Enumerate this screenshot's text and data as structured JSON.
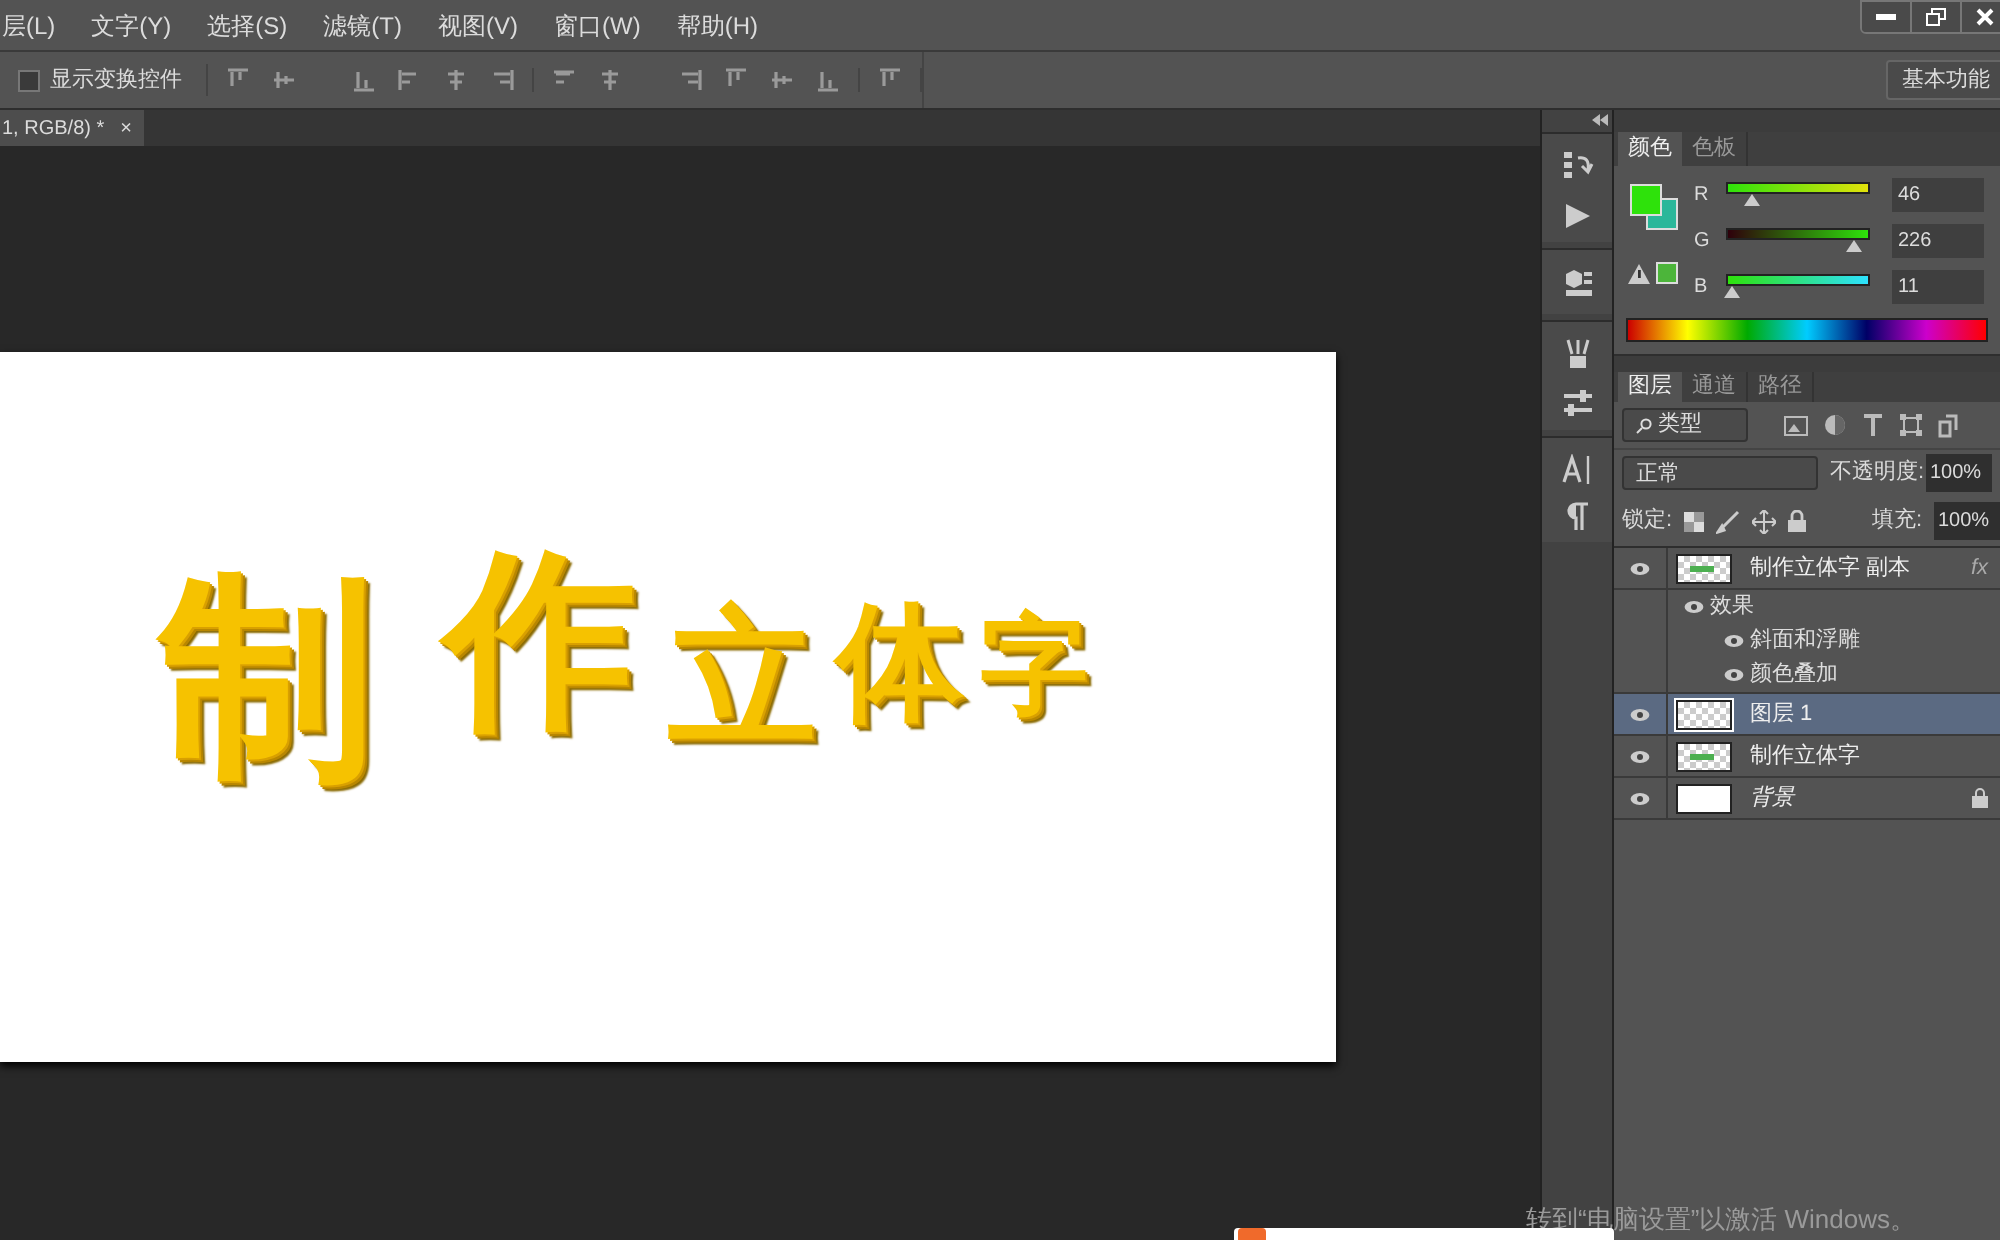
{
  "menu": [
    {
      "label": "层(L)"
    },
    {
      "label": "文字(Y)"
    },
    {
      "label": "选择(S)"
    },
    {
      "label": "滤镜(T)"
    },
    {
      "label": "视图(V)"
    },
    {
      "label": "窗口(W)"
    },
    {
      "label": "帮助(H)"
    }
  ],
  "options_bar": {
    "show_transform": {
      "label": "显示变换控件",
      "checked": false
    },
    "workspace": "基本功能"
  },
  "document_tab": {
    "title": "1, RGB/8) *",
    "close": "×"
  },
  "canvas": {
    "text": "制作立体字"
  },
  "color_panel": {
    "tabs": [
      {
        "label": "颜色",
        "selected": true
      },
      {
        "label": "色板",
        "selected": false
      }
    ],
    "channels": [
      {
        "name": "R",
        "value": "46",
        "level": 0.18
      },
      {
        "name": "G",
        "value": "226",
        "level": 0.886
      },
      {
        "name": "B",
        "value": "11",
        "level": 0.043
      }
    ]
  },
  "layers_panel": {
    "tabs": [
      {
        "label": "图层",
        "selected": true
      },
      {
        "label": "通道",
        "selected": false
      },
      {
        "label": "路径",
        "selected": false
      }
    ],
    "filter": "类型",
    "blend_mode": "正常",
    "opacity_label": "不透明度:",
    "opacity": "100%",
    "lock_label": "锁定:",
    "fill_label": "填充:",
    "fill": "100%",
    "layers": [
      {
        "name": "制作立体字 副本",
        "kind": "text",
        "selected": false,
        "effects_badge": "fx",
        "children": [
          {
            "name": "效果",
            "children": [
              {
                "name": "斜面和浮雕"
              },
              {
                "name": "颜色叠加"
              }
            ]
          }
        ]
      },
      {
        "name": "图层 1",
        "kind": "empty",
        "selected": true
      },
      {
        "name": "制作立体字",
        "kind": "text",
        "selected": false
      },
      {
        "name": "背景",
        "kind": "background",
        "selected": false,
        "locked": true
      }
    ]
  },
  "system_notice": "转到“电脑设置”以激活 Windows。"
}
